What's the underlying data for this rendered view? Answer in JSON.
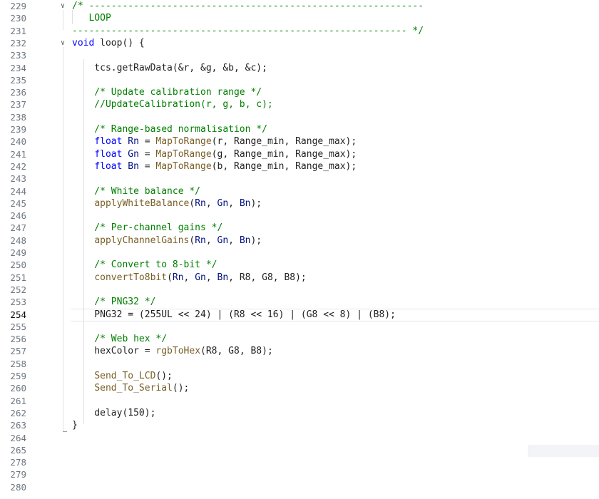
{
  "editor": {
    "active_line": "254",
    "lines": [
      {
        "n": "229",
        "fold": "v",
        "tokens": [
          {
            "t": "/* ------------------------------------------------------------",
            "c": "c-cmt"
          }
        ]
      },
      {
        "n": "230",
        "fold": "",
        "tokens": [
          {
            "t": "   LOOP",
            "c": "c-cmt"
          }
        ]
      },
      {
        "n": "231",
        "fold": "",
        "tokens": [
          {
            "t": "------------------------------------------------------------ */",
            "c": "c-cmt"
          }
        ]
      },
      {
        "n": "232",
        "fold": "v",
        "tokens": [
          {
            "t": "void",
            "c": "c-kw"
          },
          {
            "t": " loop() {",
            "c": "c-txt"
          }
        ]
      },
      {
        "n": "233",
        "fold": "",
        "tokens": []
      },
      {
        "n": "234",
        "fold": "",
        "tokens": [
          {
            "t": "    tcs.getRawData(&r, &g, &b, &c);",
            "c": "c-txt"
          }
        ]
      },
      {
        "n": "235",
        "fold": "",
        "tokens": []
      },
      {
        "n": "236",
        "fold": "",
        "tokens": [
          {
            "t": "    /* Update calibration range */",
            "c": "c-cmt"
          }
        ]
      },
      {
        "n": "237",
        "fold": "",
        "tokens": [
          {
            "t": "    //UpdateCalibration(r, g, b, c);",
            "c": "c-cmt"
          }
        ]
      },
      {
        "n": "238",
        "fold": "",
        "tokens": []
      },
      {
        "n": "239",
        "fold": "",
        "tokens": [
          {
            "t": "    /* Range-based normalisation */",
            "c": "c-cmt"
          }
        ]
      },
      {
        "n": "240",
        "fold": "",
        "tokens": [
          {
            "t": "    ",
            "c": "c-txt"
          },
          {
            "t": "float",
            "c": "c-kw"
          },
          {
            "t": " Rn",
            "c": "c-var"
          },
          {
            "t": " = ",
            "c": "c-txt"
          },
          {
            "t": "MapToRange",
            "c": "c-fn"
          },
          {
            "t": "(r, Range_min, Range_max);",
            "c": "c-txt"
          }
        ]
      },
      {
        "n": "241",
        "fold": "",
        "tokens": [
          {
            "t": "    ",
            "c": "c-txt"
          },
          {
            "t": "float",
            "c": "c-kw"
          },
          {
            "t": " Gn",
            "c": "c-var"
          },
          {
            "t": " = ",
            "c": "c-txt"
          },
          {
            "t": "MapToRange",
            "c": "c-fn"
          },
          {
            "t": "(g, Range_min, Range_max);",
            "c": "c-txt"
          }
        ]
      },
      {
        "n": "242",
        "fold": "",
        "tokens": [
          {
            "t": "    ",
            "c": "c-txt"
          },
          {
            "t": "float",
            "c": "c-kw"
          },
          {
            "t": " Bn",
            "c": "c-var"
          },
          {
            "t": " = ",
            "c": "c-txt"
          },
          {
            "t": "MapToRange",
            "c": "c-fn"
          },
          {
            "t": "(b, Range_min, Range_max);",
            "c": "c-txt"
          }
        ]
      },
      {
        "n": "243",
        "fold": "",
        "tokens": []
      },
      {
        "n": "244",
        "fold": "",
        "tokens": [
          {
            "t": "    /* White balance */",
            "c": "c-cmt"
          }
        ]
      },
      {
        "n": "245",
        "fold": "",
        "tokens": [
          {
            "t": "    ",
            "c": "c-txt"
          },
          {
            "t": "applyWhiteBalance",
            "c": "c-fn"
          },
          {
            "t": "(",
            "c": "c-txt"
          },
          {
            "t": "Rn",
            "c": "c-var"
          },
          {
            "t": ", ",
            "c": "c-txt"
          },
          {
            "t": "Gn",
            "c": "c-var"
          },
          {
            "t": ", ",
            "c": "c-txt"
          },
          {
            "t": "Bn",
            "c": "c-var"
          },
          {
            "t": ");",
            "c": "c-txt"
          }
        ]
      },
      {
        "n": "246",
        "fold": "",
        "tokens": []
      },
      {
        "n": "247",
        "fold": "",
        "tokens": [
          {
            "t": "    /* Per-channel gains */",
            "c": "c-cmt"
          }
        ]
      },
      {
        "n": "248",
        "fold": "",
        "tokens": [
          {
            "t": "    ",
            "c": "c-txt"
          },
          {
            "t": "applyChannelGains",
            "c": "c-fn"
          },
          {
            "t": "(",
            "c": "c-txt"
          },
          {
            "t": "Rn",
            "c": "c-var"
          },
          {
            "t": ", ",
            "c": "c-txt"
          },
          {
            "t": "Gn",
            "c": "c-var"
          },
          {
            "t": ", ",
            "c": "c-txt"
          },
          {
            "t": "Bn",
            "c": "c-var"
          },
          {
            "t": ");",
            "c": "c-txt"
          }
        ]
      },
      {
        "n": "249",
        "fold": "",
        "tokens": []
      },
      {
        "n": "250",
        "fold": "",
        "tokens": [
          {
            "t": "    /* Convert to 8-bit */",
            "c": "c-cmt"
          }
        ]
      },
      {
        "n": "251",
        "fold": "",
        "tokens": [
          {
            "t": "    ",
            "c": "c-txt"
          },
          {
            "t": "convertTo8bit",
            "c": "c-fn"
          },
          {
            "t": "(",
            "c": "c-txt"
          },
          {
            "t": "Rn",
            "c": "c-var"
          },
          {
            "t": ", ",
            "c": "c-txt"
          },
          {
            "t": "Gn",
            "c": "c-var"
          },
          {
            "t": ", ",
            "c": "c-txt"
          },
          {
            "t": "Bn",
            "c": "c-var"
          },
          {
            "t": ", R8, G8, B8);",
            "c": "c-txt"
          }
        ]
      },
      {
        "n": "252",
        "fold": "",
        "tokens": []
      },
      {
        "n": "253",
        "fold": "",
        "tokens": [
          {
            "t": "    /* PNG32 */",
            "c": "c-cmt"
          }
        ]
      },
      {
        "n": "254",
        "fold": "",
        "tokens": [
          {
            "t": "    PNG32 = (255UL << 24) | (R8 << 16) | (G8 << 8) | (B8);",
            "c": "c-txt"
          }
        ]
      },
      {
        "n": "255",
        "fold": "",
        "tokens": []
      },
      {
        "n": "256",
        "fold": "",
        "tokens": [
          {
            "t": "    /* Web hex */",
            "c": "c-cmt"
          }
        ]
      },
      {
        "n": "257",
        "fold": "",
        "tokens": [
          {
            "t": "    hexColor = ",
            "c": "c-txt"
          },
          {
            "t": "rgbToHex",
            "c": "c-fn"
          },
          {
            "t": "(R8, G8, B8);",
            "c": "c-txt"
          }
        ]
      },
      {
        "n": "258",
        "fold": "",
        "tokens": []
      },
      {
        "n": "259",
        "fold": "",
        "tokens": [
          {
            "t": "    ",
            "c": "c-txt"
          },
          {
            "t": "Send_To_LCD",
            "c": "c-fn"
          },
          {
            "t": "();",
            "c": "c-txt"
          }
        ]
      },
      {
        "n": "260",
        "fold": "",
        "tokens": [
          {
            "t": "    ",
            "c": "c-txt"
          },
          {
            "t": "Send_To_Serial",
            "c": "c-fn"
          },
          {
            "t": "();",
            "c": "c-txt"
          }
        ]
      },
      {
        "n": "261",
        "fold": "",
        "tokens": []
      },
      {
        "n": "262",
        "fold": "",
        "tokens": [
          {
            "t": "    delay(150);",
            "c": "c-txt"
          }
        ]
      },
      {
        "n": "263",
        "fold": "",
        "tokens": [
          {
            "t": "}",
            "c": "c-txt"
          }
        ]
      },
      {
        "n": "264",
        "fold": "",
        "tokens": []
      },
      {
        "n": "265",
        "fold": "",
        "tokens": []
      },
      {
        "n": "278",
        "fold": "",
        "tokens": []
      },
      {
        "n": "279",
        "fold": "",
        "tokens": []
      },
      {
        "n": "280",
        "fold": "",
        "tokens": []
      }
    ]
  }
}
